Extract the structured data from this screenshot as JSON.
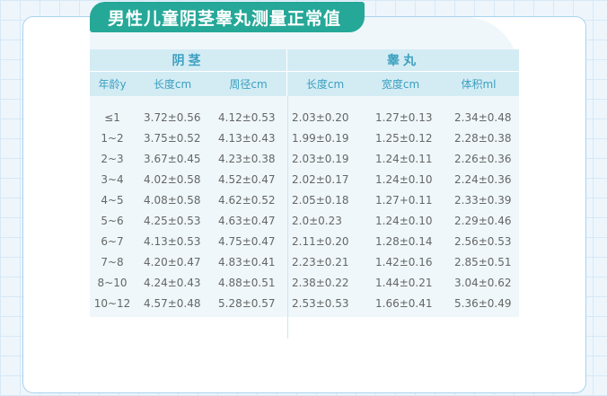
{
  "title": "男性儿童阴茎睾丸测量正常值",
  "groups": {
    "penis": "阴茎",
    "testis": "睾丸"
  },
  "columns": [
    "年龄y",
    "长度cm",
    "周径cm",
    "长度cm",
    "宽度cm",
    "体积ml"
  ],
  "rows": [
    [
      "≤1",
      "3.72±0.56",
      "4.12±0.53",
      "2.03±0.20",
      "1.27±0.13",
      "2.34±0.48"
    ],
    [
      "1~2",
      "3.75±0.52",
      "4.13±0.43",
      "1.99±0.19",
      "1.25±0.12",
      "2.28±0.38"
    ],
    [
      "2~3",
      "3.67±0.45",
      "4.23±0.38",
      "2.03±0.19",
      "1.24±0.11",
      "2.26±0.36"
    ],
    [
      "3~4",
      "4.02±0.58",
      "4.52±0.47",
      "2.02±0.17",
      "1.24±0.10",
      "2.24±0.36"
    ],
    [
      "4~5",
      "4.08±0.58",
      "4.62±0.52",
      "2.05±0.18",
      "1.27+0.11",
      "2.33±0.39"
    ],
    [
      "5~6",
      "4.25±0.53",
      "4.63±0.47",
      "2.0±0.23",
      "1.24±0.10",
      "2.29±0.46"
    ],
    [
      "6~7",
      "4.13±0.53",
      "4.75±0.47",
      "2.11±0.20",
      "1.28±0.14",
      "2.56±0.53"
    ],
    [
      "7~8",
      "4.20±0.47",
      "4.83±0.41",
      "2.23±0.21",
      "1.42±0.16",
      "2.85±0.51"
    ],
    [
      "8~10",
      "4.24±0.43",
      "4.88±0.51",
      "2.38±0.22",
      "1.44±0.21",
      "3.04±0.62"
    ],
    [
      "10~12",
      "4.57±0.48",
      "5.28±0.57",
      "2.53±0.53",
      "1.66±0.41",
      "5.36±0.49"
    ]
  ]
}
